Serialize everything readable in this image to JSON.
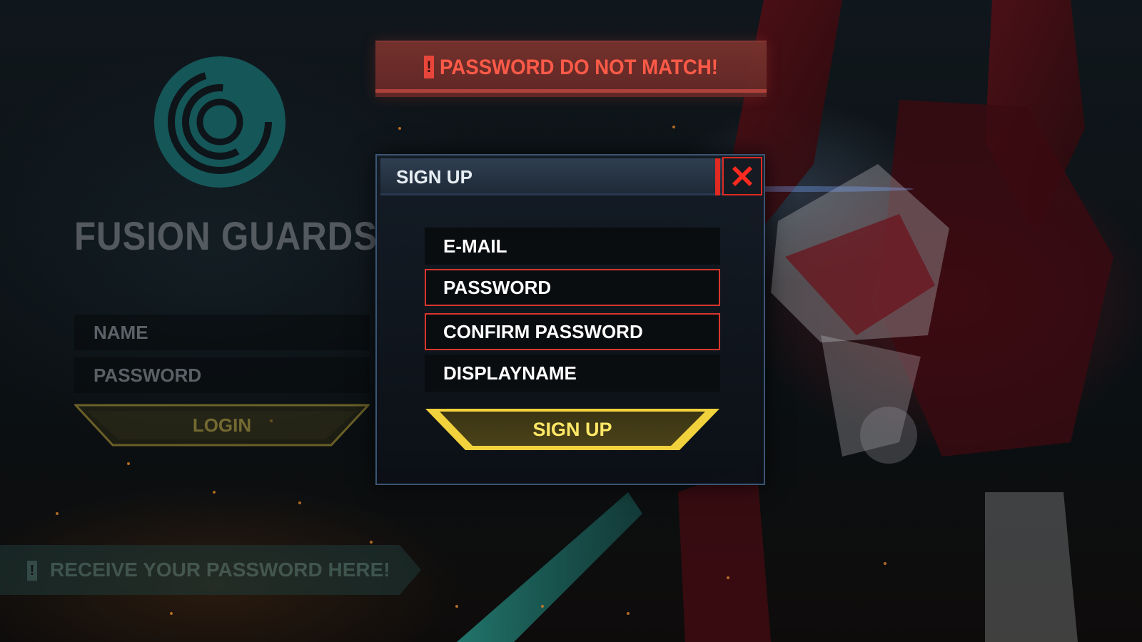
{
  "brand": {
    "name": "FUSION GUARDS"
  },
  "login": {
    "name_label": "NAME",
    "password_label": "PASSWORD",
    "button_label": "LOGIN"
  },
  "notice": {
    "receive_text": "RECEIVE YOUR PASSWORD HERE!",
    "bang": "!"
  },
  "error_banner": {
    "bang": "!",
    "message": "PASSWORD DO NOT MATCH!"
  },
  "dialog": {
    "title": "SIGN UP",
    "fields": [
      {
        "label": "E-MAIL",
        "state": "normal"
      },
      {
        "label": "PASSWORD",
        "state": "error"
      },
      {
        "label": "CONFIRM PASSWORD",
        "state": "error"
      },
      {
        "label": "DISPLAYNAME",
        "state": "normal"
      }
    ],
    "submit_label": "SIGN UP",
    "close_icon": "close-x-icon"
  },
  "colors": {
    "accent_yellow": "#f2d23c",
    "error_red": "#e02a22",
    "logo_teal": "#1a8a8a"
  }
}
